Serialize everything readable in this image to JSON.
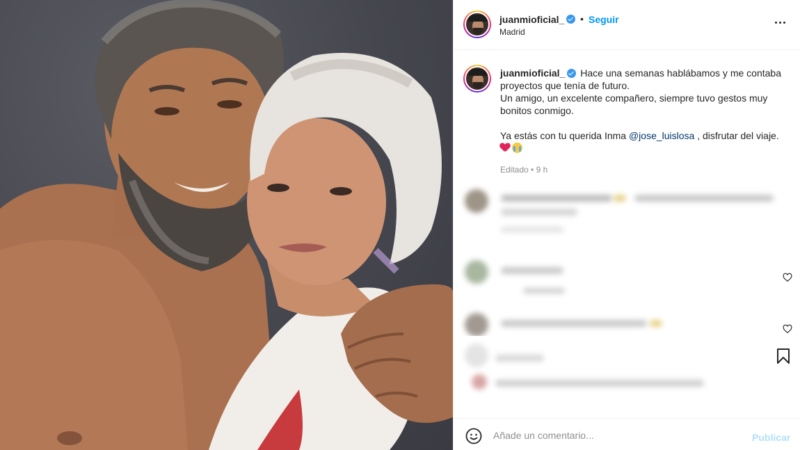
{
  "post": {
    "username": "juanmioficial_",
    "follow_label": "Seguir",
    "separator": "•",
    "location": "Madrid",
    "more_icon": "more-options-icon"
  },
  "caption": {
    "username": "juanmioficial_",
    "line1": "Hace una semanas hablábamos y me contaba proyectos que tenía de futuro.",
    "line2": "Un amigo, un excelente compañero, siempre tuvo gestos muy bonitos conmigo.",
    "line3_pre": "Ya estás con tu querida Inma ",
    "mention": "@jose_luislosa",
    "line3_post": " , disfrutar del viaje.",
    "emojis": [
      "red-heart",
      "crying-face"
    ],
    "edited_label": "Editado",
    "dot": " • ",
    "time": "9 h"
  },
  "comment_bar": {
    "placeholder": "Añade un comentario...",
    "publish_label": "Publicar"
  },
  "colors": {
    "accent": "#0095f6",
    "publish_disabled": "#b2dffc",
    "mention": "#00376b",
    "verified": "#3897f0",
    "muted": "#8e8e8e"
  }
}
